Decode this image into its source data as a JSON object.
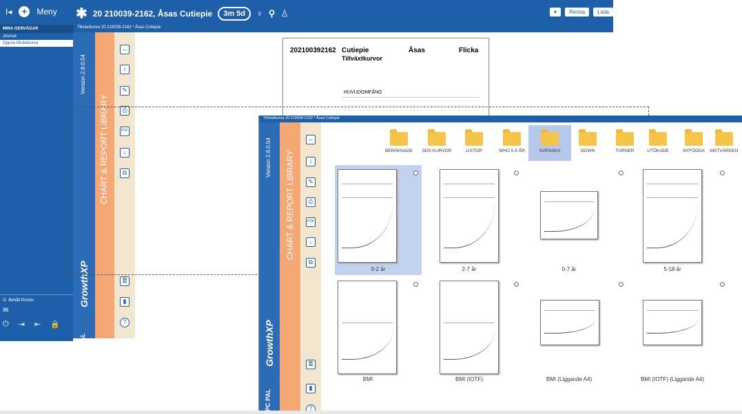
{
  "topbar": {
    "nav_prev": "I◂",
    "menu": "Meny",
    "patient": "20 210039-2162, Åsas Cutiepie",
    "age": "3m 5d",
    "btn_rensa": "Rensa",
    "btn_lista": "Lista"
  },
  "leftnav": {
    "header": "MINA GENVÄGAR",
    "items": [
      "Journal",
      "Öppna tillväxtkurva"
    ],
    "keep_label": "Behåll fönster"
  },
  "tab": {
    "title": "Tillväxtkurva 20 210039-2162 * Åsas Cutiepie"
  },
  "library": {
    "title": "Tillväxtkurva 20 210039-2162 * Åsas Cutiepie",
    "version": "Version 2.8.0.54",
    "lib_label": "CHART & REPORT LIBRARY",
    "brand": "GrowthXP",
    "pcpal": "PC PAL",
    "folders": [
      "BERÄKNADE",
      "SDS KURVOR",
      "LISTOR",
      "WHO 0-5 ÅR",
      "SVENSKA",
      "DOWN",
      "TURNER",
      "UTÖKADE",
      "NYFÖDDA",
      "MÄTVÄRDEN"
    ],
    "selected_folder": "SVENSKA",
    "cards_row1": [
      "0-2 år",
      "2-7 år",
      "0-7 år",
      "5-18 år"
    ],
    "cards_row2": [
      "BMI",
      "BMI (IOTF)",
      "BMI (Liggande A4)",
      "BMI (IOTF) (Liggande A4)"
    ]
  },
  "back": {
    "version": "Version 2.8.0.54",
    "lib_label": "CHART & REPORT LIBRARY",
    "brand": "GrowthXP",
    "pcpal": "PC PAL"
  },
  "doc": {
    "pid": "202100392162",
    "name": "Cutiepie",
    "first": "Åsas",
    "sex": "Flicka",
    "heading": "Tillväxtkurvor",
    "chart_label": "HUVUDOMFÅNG"
  }
}
